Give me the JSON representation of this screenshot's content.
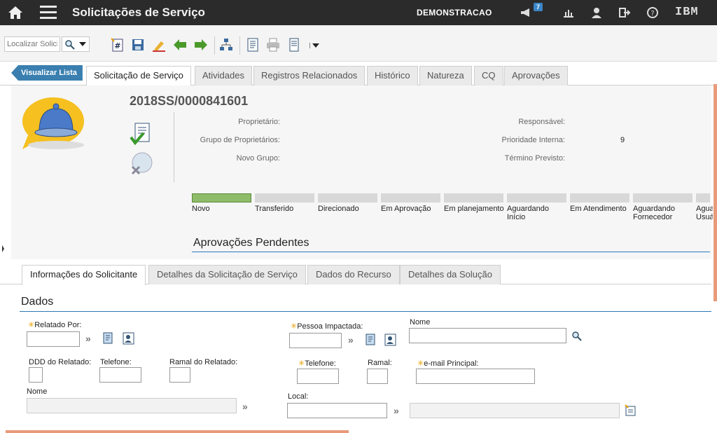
{
  "header": {
    "title": "Solicitações de Serviço",
    "user": "DEMONSTRACAO",
    "notifications": "7",
    "brand": "IBM",
    "icons": [
      "home-icon",
      "menu-icon",
      "megaphone-icon",
      "chart-icon",
      "person-icon",
      "logout-icon",
      "help-icon"
    ]
  },
  "toolbar": {
    "search_placeholder": "Localizar Solicit",
    "icons": [
      "new-record-icon",
      "save-icon",
      "clear-icon",
      "previous-icon",
      "next-icon",
      "workflow-icon",
      "report-icon",
      "print-icon",
      "more-actions-icon"
    ]
  },
  "tabs": {
    "back_label": "Visualizar Lista",
    "items": [
      "Solicitação de Serviço",
      "Atividades",
      "Registros Relacionados",
      "Histórico",
      "Natureza",
      "CQ",
      "Aprovações"
    ],
    "active": "Solicitação de Serviço"
  },
  "record": {
    "number": "2018SS/0000841601",
    "fields": {
      "owner_label": "Proprietário:",
      "owner_group_label": "Grupo de Proprietários:",
      "new_group_label": "Novo Grupo:",
      "responsible_label": "Responsável:",
      "internal_priority_label": "Prioridade Interna:",
      "internal_priority_value": "9",
      "expected_end_label": "Término Previsto:"
    },
    "stages": [
      "Novo",
      "Transferido",
      "Direcionado",
      "Em Aprovação",
      "Em planejamento",
      "Aguardando Início",
      "Em Atendimento",
      "Aguardando Fornecedor",
      "Aguardando Usuário"
    ],
    "active_stage": "Novo",
    "pending_approvals": "Aprovações Pendentes"
  },
  "subtabs": {
    "items": [
      "Informações do Solicitante",
      "Detalhes da Solicitação de Serviço",
      "Dados do Recurso",
      "Detalhes da Solução"
    ],
    "active": "Informações do Solicitante"
  },
  "form": {
    "section": "Dados",
    "reported_by": "Relatado Por:",
    "reporter_ddd": "DDD do Relatado:",
    "reporter_phone": "Telefone:",
    "reporter_ext": "Ramal do Relatado:",
    "reporter_name": "Nome",
    "affected_person": "Pessoa Impactada:",
    "affected_name": "Nome",
    "affected_phone": "Telefone:",
    "affected_ext": "Ramal:",
    "affected_email": "e-mail Principal:",
    "location": "Local:"
  }
}
